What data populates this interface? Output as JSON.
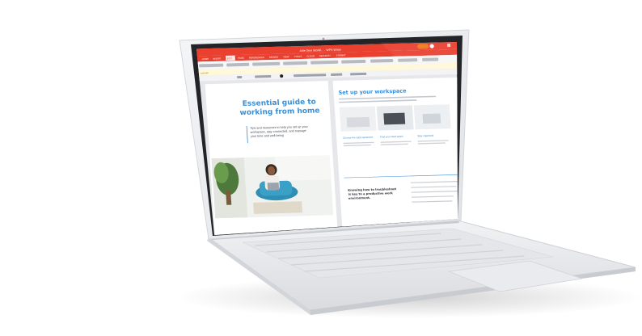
{
  "app": {
    "window_title": "Jolie Dice Workfl... - WPS Writer",
    "ribbon_tabs": [
      "HOME",
      "INSERT",
      "EDIT",
      "PAGE",
      "REFERENCES",
      "REVIEW",
      "VIEW",
      "TOOLS",
      "CLOUD",
      "SECURITY",
      "FORMAT"
    ],
    "active_tab": "EDIT",
    "status_snippet": "Last edit",
    "accent_color": "#e94030"
  },
  "document": {
    "left_page": {
      "title": "Essential guide to working from home",
      "title_line1": "Essential guide to",
      "title_line2": "working from home",
      "subtitle": "Tips and resources to help you set up your workspace, stay connected, and manage your time and well-being",
      "subtitle_line1": "Tips and resources to help you set up your",
      "subtitle_line2": "workspace, stay connected, and manage",
      "subtitle_line3": "your time and well-being"
    },
    "right_page": {
      "heading": "Set up your workspace",
      "cards": [
        "Choose the right equipment",
        "Find your ideal space",
        "Stay organized"
      ],
      "bottom_heading_line1": "Knowing how to troubleshoot",
      "bottom_heading_line2": "is key to a productive work",
      "bottom_heading_line3": "environment."
    },
    "colors": {
      "title_blue": "#3a8fd8",
      "heading_blue": "#3a8fd8",
      "text_gray": "#5a6070"
    }
  }
}
